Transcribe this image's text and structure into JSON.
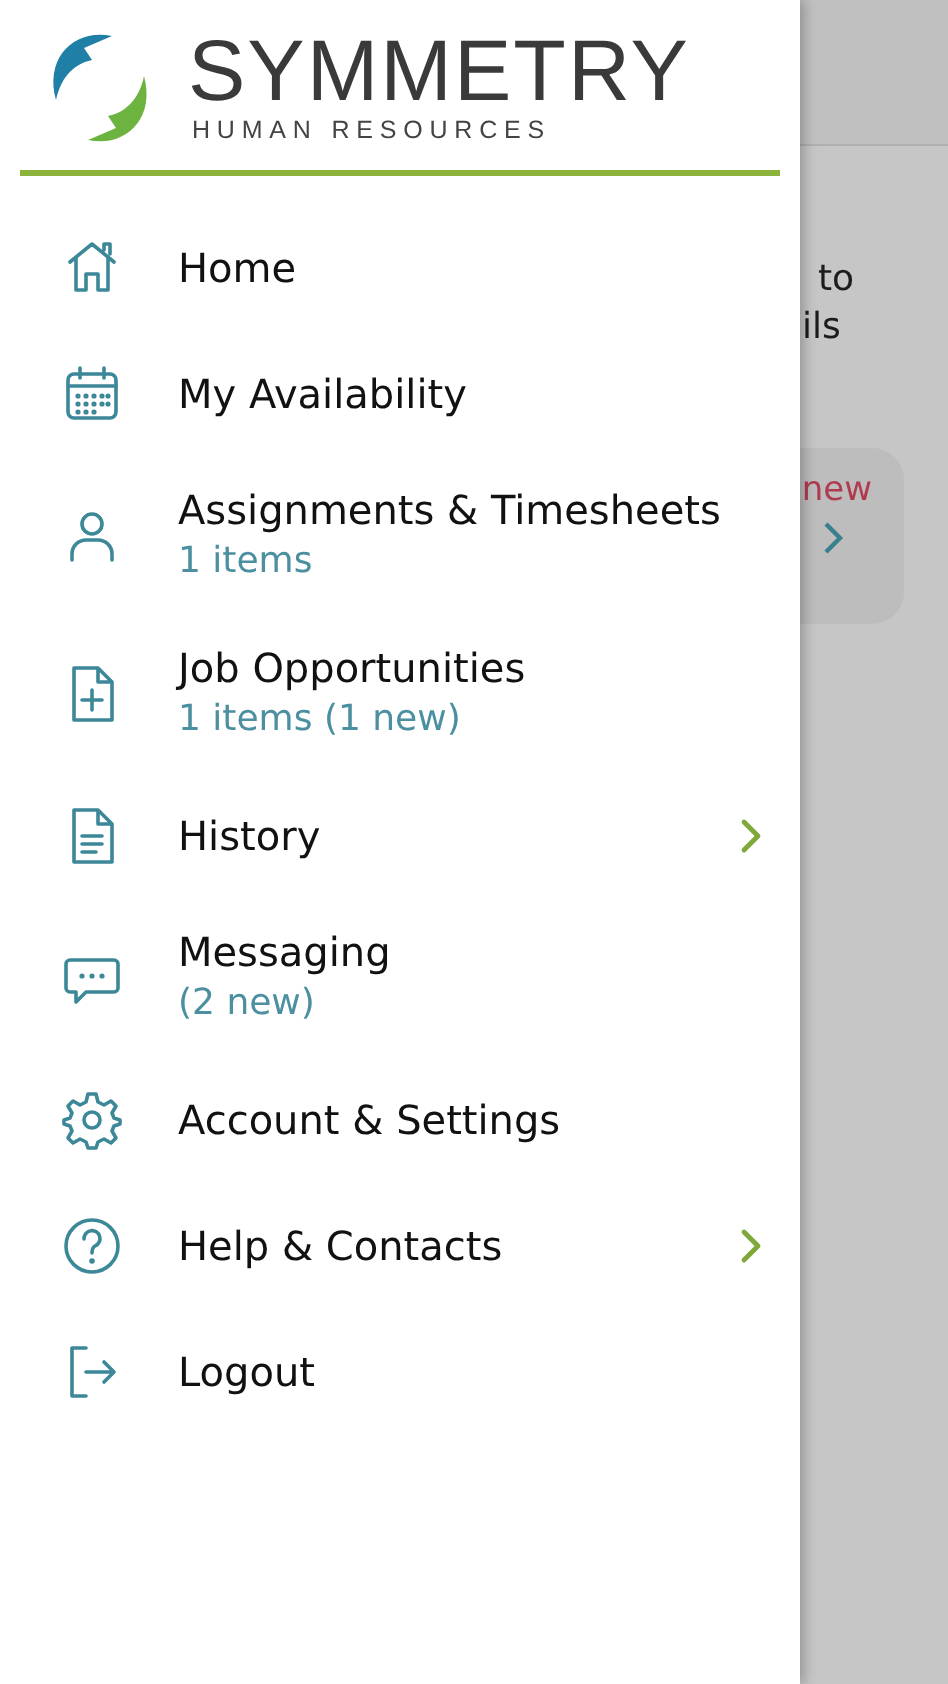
{
  "logo": {
    "name": "SYMMETRY",
    "tagline": "HUMAN RESOURCES"
  },
  "menu": [
    {
      "kind": "home",
      "title": "Home",
      "submenu": false
    },
    {
      "kind": "calendar",
      "title": "My Availability",
      "submenu": false
    },
    {
      "kind": "person",
      "title": "Assignments & Timesheets",
      "subtitle": "1 items",
      "submenu": false
    },
    {
      "kind": "file-plus",
      "title": "Job Opportunities",
      "subtitle": "1 items (1 new)",
      "submenu": false
    },
    {
      "kind": "document",
      "title": "History",
      "submenu": true
    },
    {
      "kind": "chat",
      "title": "Messaging",
      "subtitle": "(2 new)",
      "submenu": false
    },
    {
      "kind": "gear",
      "title": "Account & Settings",
      "submenu": false
    },
    {
      "kind": "help",
      "title": "Help & Contacts",
      "submenu": true
    },
    {
      "kind": "logout",
      "title": "Logout",
      "submenu": false
    }
  ],
  "background_page": {
    "text_lines": [
      "to",
      "ils"
    ],
    "card_badge": "new"
  }
}
